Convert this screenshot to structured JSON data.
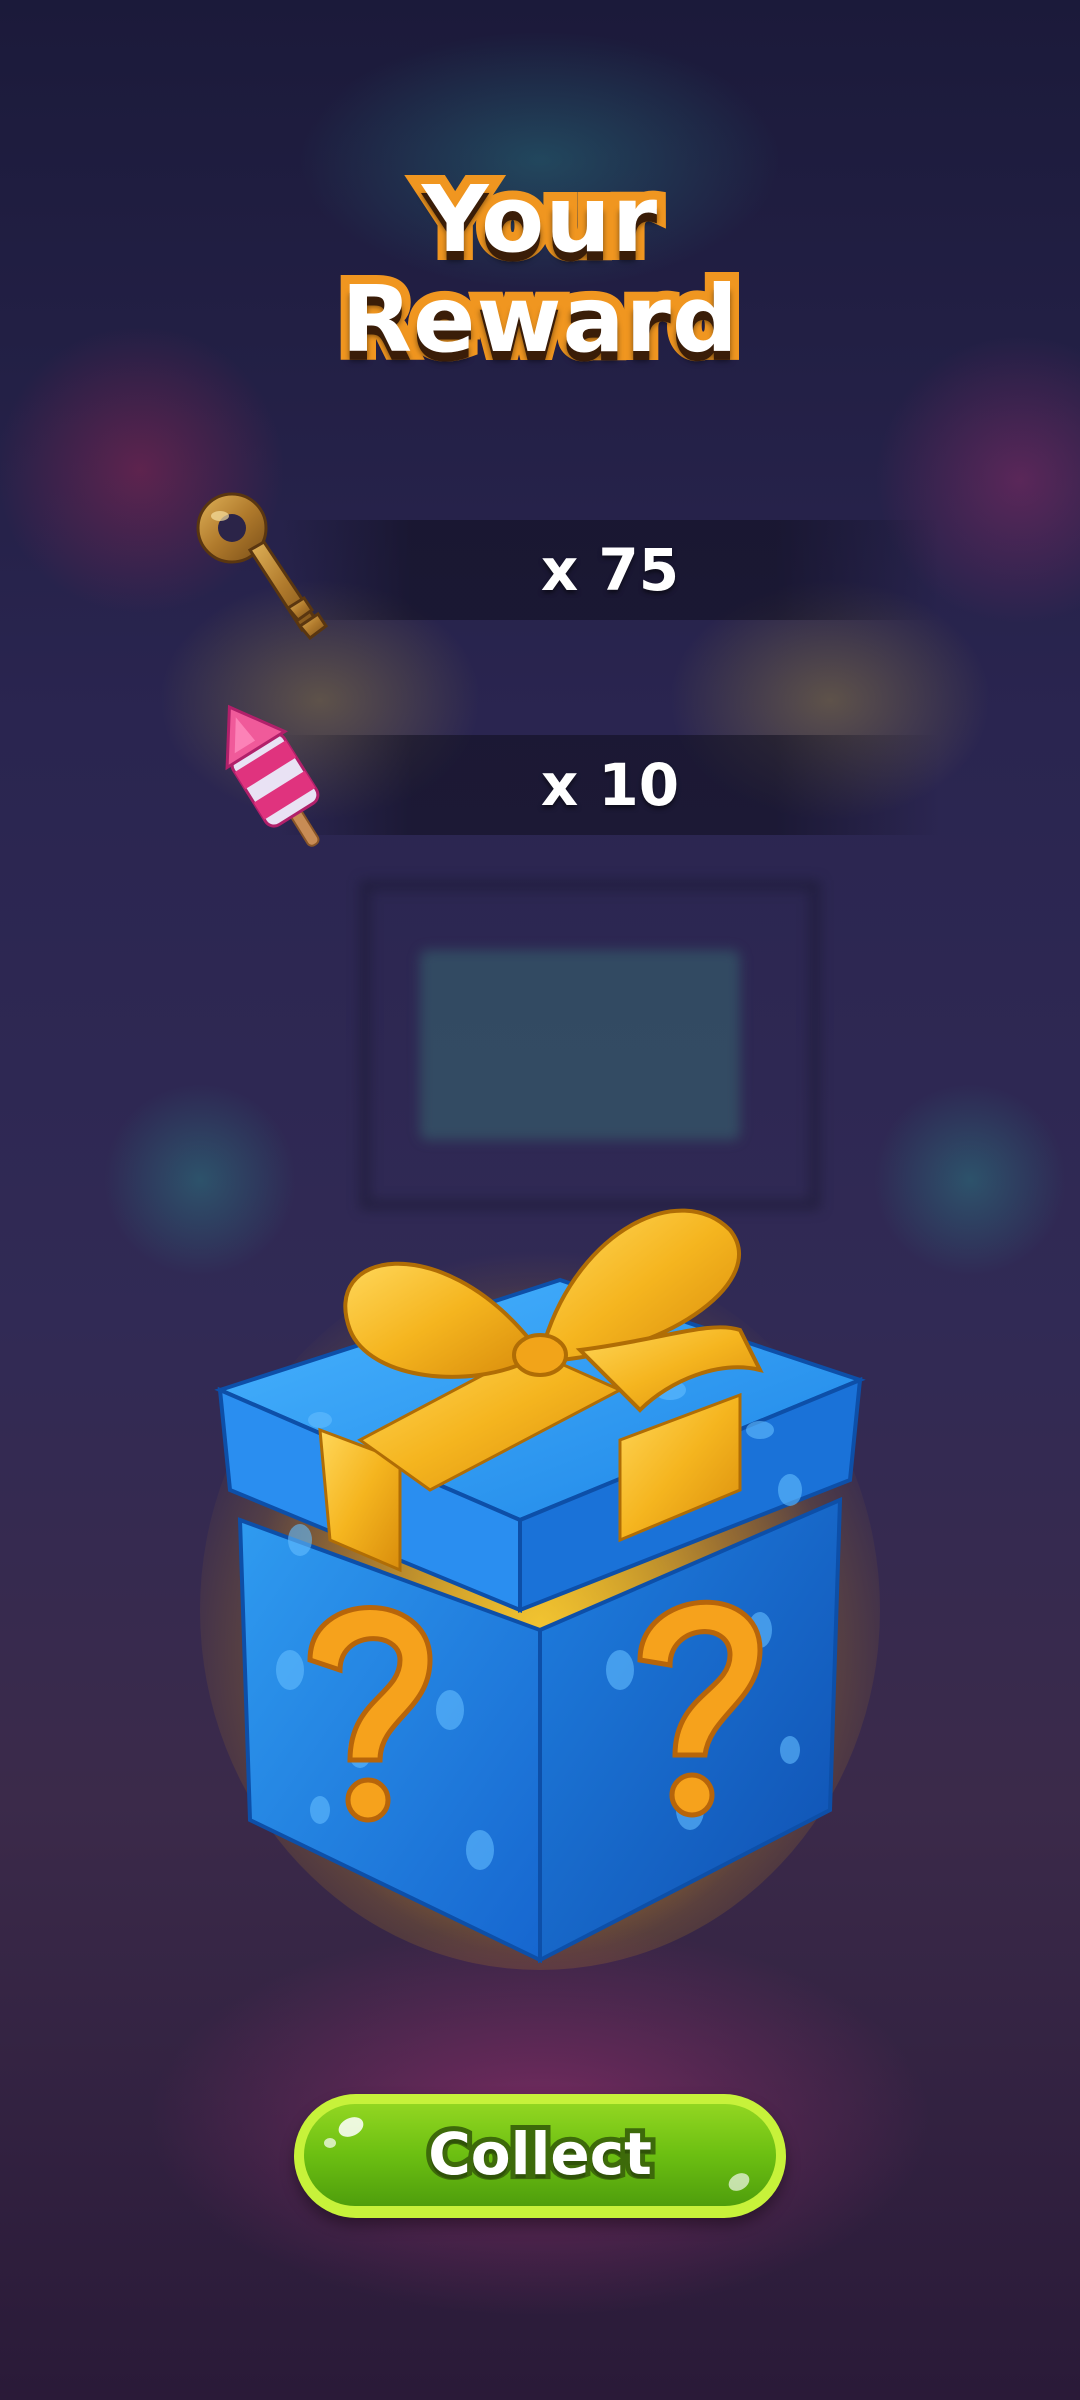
{
  "title": {
    "line1": "Your",
    "line2": "Reward"
  },
  "rewards": [
    {
      "icon": "key-icon",
      "count_label": "x 75"
    },
    {
      "icon": "rocket-icon",
      "count_label": "x 10"
    }
  ],
  "gift": {
    "icon": "mystery-gift-box-icon"
  },
  "collect_button": {
    "label": "Collect"
  },
  "colors": {
    "title_outline": "#f09620",
    "button_green": "#6cbf12",
    "button_rim": "#c7f23a",
    "gift_blue": "#1e88e5",
    "ribbon_gold": "#f5b51f"
  }
}
